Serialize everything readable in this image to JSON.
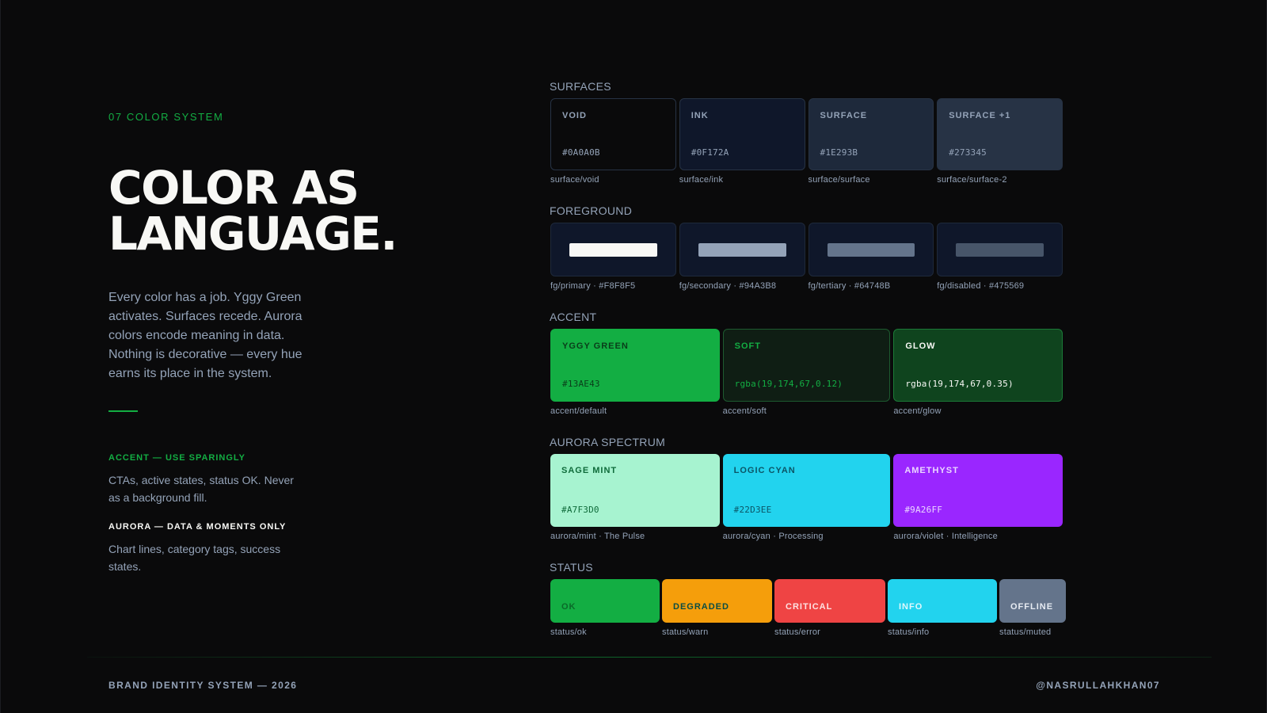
{
  "eyebrow": "07 COLOR SYSTEM",
  "headline": {
    "line1": "COLOR AS",
    "line2": "LANGUAGE."
  },
  "lede": "Every color has a job. Yggy Green activates. Surfaces recede. Aurora colors encode meaning in data. Nothing is decorative — every hue earns its place in the system.",
  "notes": {
    "accent": {
      "title": "ACCENT — USE SPARINGLY",
      "body": "CTAs, active states, status OK. Never as a background fill."
    },
    "aurora": {
      "title": "AURORA — DATA & MOMENTS ONLY",
      "body": "Chart lines, category tags, success states."
    }
  },
  "sections": {
    "surfaces": {
      "label": "SURFACES",
      "swatches": [
        {
          "name": "VOID",
          "hex": "#0A0A0B",
          "token": "surface/void",
          "color": "#0a0a0b"
        },
        {
          "name": "INK",
          "hex": "#0F172A",
          "token": "surface/ink",
          "color": "#0f172a"
        },
        {
          "name": "SURFACE",
          "hex": "#1E293B",
          "token": "surface/surface",
          "color": "#1e293b"
        },
        {
          "name": "SURFACE +1",
          "hex": "#273345",
          "token": "surface/surface-2",
          "color": "#273345"
        }
      ]
    },
    "foreground": {
      "label": "FOREGROUND",
      "swatches": [
        {
          "caption": "fg/primary · #F8F8F5",
          "color": "#f8f8f5"
        },
        {
          "caption": "fg/secondary · #94A3B8",
          "color": "#94a3b8"
        },
        {
          "caption": "fg/tertiary · #64748B",
          "color": "#64748b"
        },
        {
          "caption": "fg/disabled · #475569",
          "color": "#475569"
        }
      ]
    },
    "accent": {
      "label": "ACCENT",
      "swatches": [
        {
          "name": "YGGY GREEN",
          "value": "#13AE43",
          "token": "accent/default",
          "color": "#13ae43",
          "text_color": "#0a3d1a",
          "border": "#13ae43"
        },
        {
          "name": "SOFT",
          "value": "rgba(19,174,67,0.12)",
          "token": "accent/soft",
          "color": "#0f1e14",
          "text_color": "#13ae43",
          "border": "#1d5a2f"
        },
        {
          "name": "GLOW",
          "value": "rgba(19,174,67,0.35)",
          "token": "accent/glow",
          "color": "#0f441e",
          "text_color": "#f8f8f5",
          "border": "#1b7a37"
        }
      ]
    },
    "aurora": {
      "label": "AURORA SPECTRUM",
      "swatches": [
        {
          "name": "SAGE MINT",
          "hex": "#A7F3D0",
          "token": "aurora/mint · The Pulse",
          "color": "#a7f3d0",
          "text_color": "#0f6b3a"
        },
        {
          "name": "LOGIC CYAN",
          "hex": "#22D3EE",
          "token": "aurora/cyan · Processing",
          "color": "#22d3ee",
          "text_color": "#0b5566"
        },
        {
          "name": "AMETHYST",
          "hex": "#9A26FF",
          "token": "aurora/violet · Intelligence",
          "color": "#9a26ff",
          "text_color": "#ead6ff"
        }
      ]
    },
    "status": {
      "label": "STATUS",
      "swatches": [
        {
          "name": "OK",
          "token": "status/ok",
          "color": "#13ae43",
          "text_color": "#0a6a29"
        },
        {
          "name": "DEGRADED",
          "token": "status/warn",
          "color": "#f59e0b",
          "text_color": "#0b4d44"
        },
        {
          "name": "CRITICAL",
          "token": "status/error",
          "color": "#ef4444",
          "text_color": "#fde2e2"
        },
        {
          "name": "INFO",
          "token": "status/info",
          "color": "#22d3ee",
          "text_color": "#dff8fc"
        },
        {
          "name": "OFFLINE",
          "token": "status/muted",
          "color": "#64748b",
          "text_color": "#e6ebf2"
        }
      ]
    }
  },
  "footer": {
    "left": "BRAND IDENTITY SYSTEM — 2026",
    "right": "@NASRULLAHKHAN07"
  }
}
